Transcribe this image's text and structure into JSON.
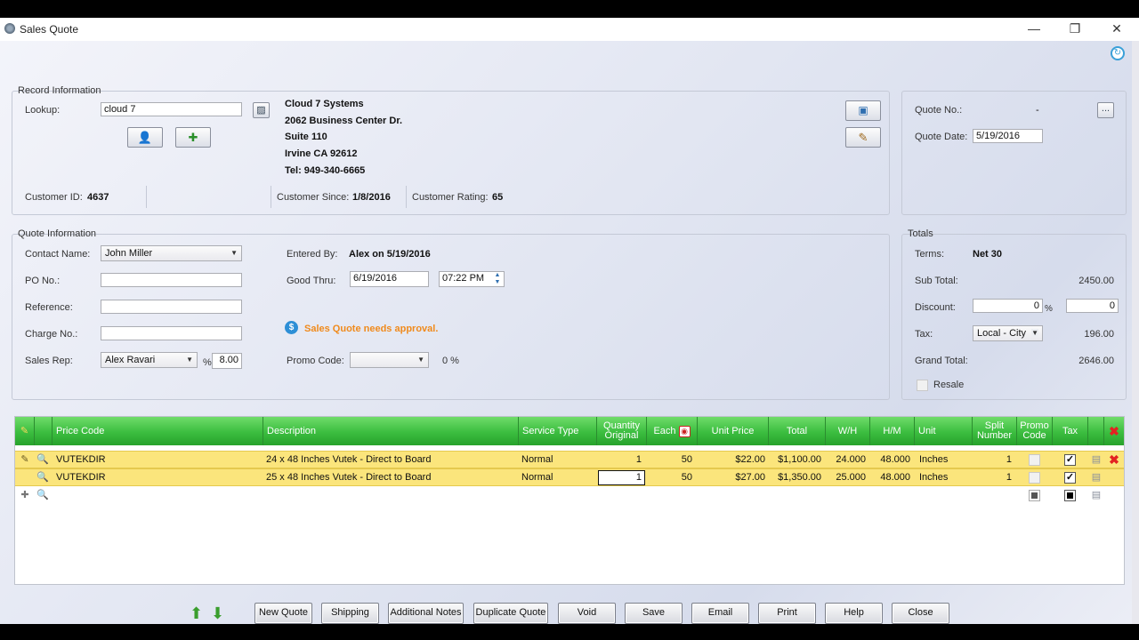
{
  "window": {
    "title": "Sales Quote",
    "minimize": "—",
    "restore": "❐",
    "close": "✕"
  },
  "record": {
    "title": "Record Information",
    "lookup_label": "Lookup:",
    "lookup_value": "cloud 7",
    "company": "Cloud 7 Systems",
    "address1": "2062 Business Center Dr.",
    "address2": "Suite 110",
    "city_line": "Irvine  CA  92612",
    "phone": "Tel: 949-340-6665",
    "customer_id_label": "Customer ID:",
    "customer_id": "4637",
    "customer_since_label": "Customer Since:",
    "customer_since": "1/8/2016",
    "customer_rating_label": "Customer Rating:",
    "customer_rating": "65"
  },
  "quote_header": {
    "quote_no_label": "Quote No.:",
    "quote_no": "-",
    "quote_date_label": "Quote Date:",
    "quote_date": "5/19/2016",
    "browse_label": "..."
  },
  "quote_info": {
    "title": "Quote Information",
    "contact_label": "Contact Name:",
    "contact_value": "John Miller",
    "po_label": "PO No.:",
    "po_value": "",
    "reference_label": "Reference:",
    "reference_value": "",
    "charge_label": "Charge No.:",
    "charge_value": "",
    "salesrep_label": "Sales Rep:",
    "salesrep_value": "Alex Ravari",
    "percent_sign": "%",
    "commission": "8.00",
    "entered_by_label": "Entered By:",
    "entered_by": "Alex on 5/19/2016",
    "good_thru_label": "Good Thru:",
    "good_thru_date": "6/19/2016",
    "good_thru_time": "07:22 PM",
    "approval_msg": "Sales Quote needs approval.",
    "promo_label": "Promo Code:",
    "promo_value": "",
    "promo_percent": "0 %"
  },
  "totals": {
    "title": "Totals",
    "terms_label": "Terms:",
    "terms": "Net 30",
    "subtotal_label": "Sub Total:",
    "subtotal": "2450.00",
    "discount_label": "Discount:",
    "discount_pct": "0",
    "discount_pct_sign": "%",
    "discount_amt": "0",
    "tax_label": "Tax:",
    "tax_select": "Local - City",
    "tax": "196.00",
    "grand_label": "Grand Total:",
    "grand": "2646.00",
    "resale_label": "Resale"
  },
  "grid": {
    "headers": {
      "price_code": "Price Code",
      "description": "Description",
      "service_type": "Service Type",
      "qty1": "Quantity",
      "qty2": "Original",
      "each": "Each",
      "unit_price": "Unit Price",
      "total": "Total",
      "wh": "W/H",
      "hm": "H/M",
      "unit": "Unit",
      "split1": "Split",
      "split2": "Number",
      "promo1": "Promo",
      "promo2": "Code",
      "tax": "Tax"
    },
    "rows": [
      {
        "price_code": "VUTEKDIR",
        "description": "24 x 48 Inches Vutek - Direct to Board",
        "service_type": "Normal",
        "qty": "1",
        "each": "50",
        "unit_price": "$22.00",
        "total": "$1,100.00",
        "wh": "24.000",
        "hm": "48.000",
        "unit": "Inches",
        "split": "1"
      },
      {
        "price_code": "VUTEKDIR",
        "description": "25 x 48 Inches Vutek - Direct to Board",
        "service_type": "Normal",
        "qty": "1",
        "each": "50",
        "unit_price": "$27.00",
        "total": "$1,350.00",
        "wh": "25.000",
        "hm": "48.000",
        "unit": "Inches",
        "split": "1"
      }
    ]
  },
  "buttons": {
    "new_quote": "New Quote",
    "shipping": "Shipping",
    "additional_notes": "Additional Notes",
    "duplicate_quote": "Duplicate Quote",
    "void": "Void",
    "save": "Save",
    "email": "Email",
    "print": "Print",
    "help": "Help",
    "close": "Close"
  },
  "colors": {
    "grid_header": "#3bbd3f",
    "row_highlight": "#fbe57c",
    "approval": "#f08a1c",
    "arrow": "#3a9e2e"
  }
}
